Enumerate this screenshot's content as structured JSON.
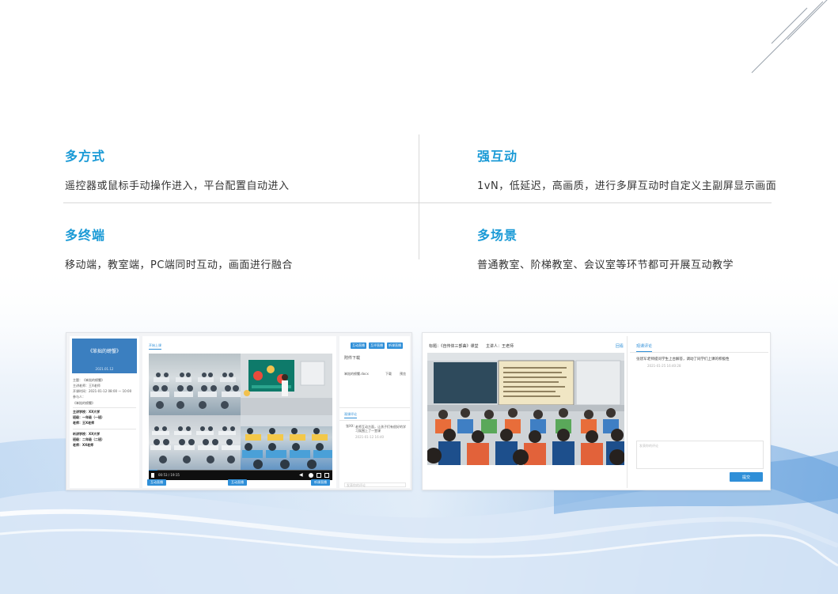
{
  "features": [
    {
      "title": "多方式",
      "desc": "遥控器或鼠标手动操作进入，平台配置自动进入"
    },
    {
      "title": "强互动",
      "desc": "1vN，低延迟，高画质，进行多屏互动时自定义主副屏显示画面"
    },
    {
      "title": "多终端",
      "desc": "移动端，教室端，PC端同时互动，画面进行融合"
    },
    {
      "title": "多场景",
      "desc": "普通教室、阶梯教室、会议室等环节都可开展互动教学"
    }
  ],
  "shot1": {
    "banner_title": "《笨拙的螃蟹》",
    "banner_date": "2021.01.12",
    "info_lines": [
      "主题：《笨拙的螃蟹》",
      "主讲老师：王X老师",
      "开课时间：2021-01-12 08:00 — 10:00",
      "参与人：",
      "《笨拙的螃蟹》"
    ],
    "schools": [
      [
        "主讲学校：XX大学",
        "班级：一年级（一班）",
        "老师：王X老师"
      ],
      [
        "听讲学校：XX大学",
        "班级：二年级（二班）",
        "老师：XX老师"
      ]
    ],
    "tab_label": "开始上课",
    "time_text": "00:53 / 19:15",
    "bottom_buttons": [
      "互动直播",
      "互动直播",
      "听课直播"
    ],
    "right_top_buttons": [
      "互动直播",
      "互评直播",
      "听课直播"
    ],
    "attachments_label": "附件下载",
    "attachment_file": "笨拙的螃蟹.docx",
    "download_label": "下载",
    "preview_label": "预览",
    "comments_tab": "观课评论",
    "comment_user": "张XX：",
    "comment_text": "老师互动方面，让孩子们有很好的学习氛围上了一堂课",
    "comment_time": "2021-01-12 16:40",
    "comment_placeholder": "发表你的评论"
  },
  "shot2": {
    "header_title": "标题：《自传体三部曲》课堂",
    "header_teacher": "主讲人：王老师",
    "return_label": "回看",
    "board_text": "《自传体三部曲》课文内容……",
    "comments_tab": "观课评论",
    "comment_user": "张建军：",
    "comment_text": "老师提问学生上台解答，调动了同学们上课的积极性",
    "comment_time": "2021-01-25 16:40:28",
    "comment_placeholder": "发表你的评论",
    "submit_label": "提交"
  }
}
